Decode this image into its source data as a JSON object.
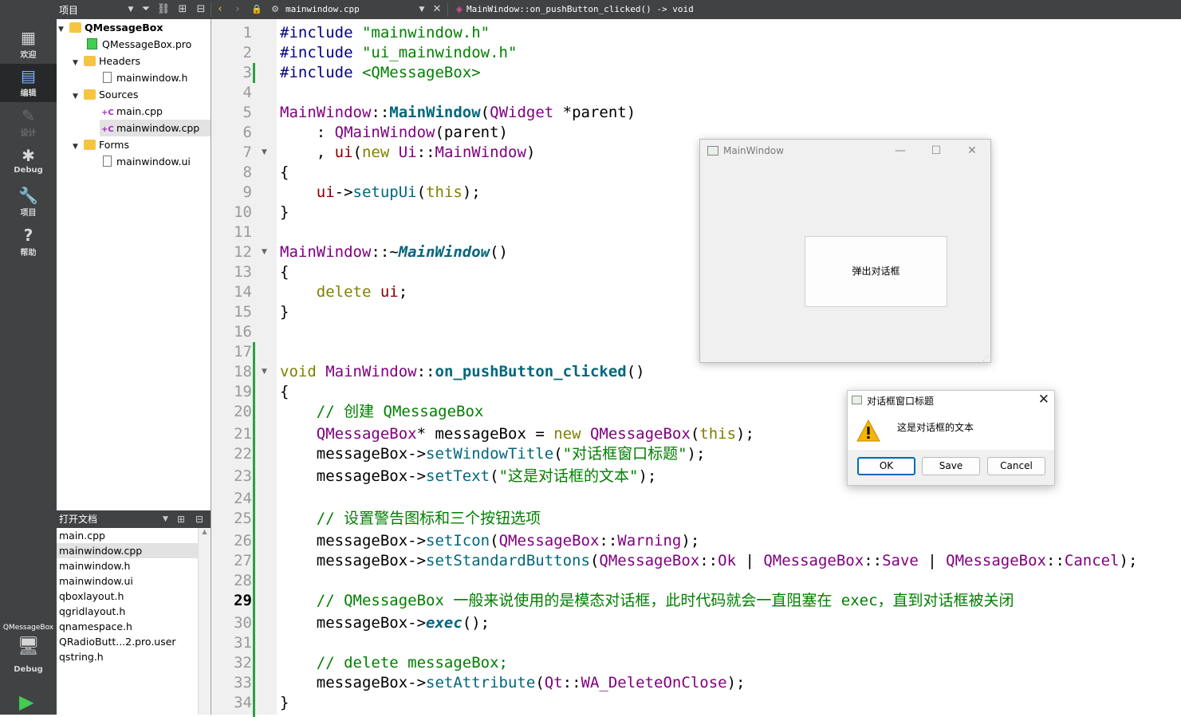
{
  "toolbar": {
    "project_label": "项目",
    "file_name": "mainwindow.cpp",
    "function_signature": "MainWindow::on_pushButton_clicked() -> void"
  },
  "modes": [
    {
      "label": "欢迎",
      "icon": "grid-icon"
    },
    {
      "label": "编辑",
      "icon": "edit-icon"
    },
    {
      "label": "设计",
      "icon": "pencil-icon"
    },
    {
      "label": "Debug",
      "icon": "bug-icon"
    },
    {
      "label": "项目",
      "icon": "wrench-icon"
    },
    {
      "label": "帮助",
      "icon": "help-icon"
    }
  ],
  "kit": {
    "project": "QMessageBox",
    "config": "Debug"
  },
  "tree": {
    "project": "QMessageBox",
    "pro_file": "QMessageBox.pro",
    "headers_label": "Headers",
    "header_file": "mainwindow.h",
    "sources_label": "Sources",
    "source_files": [
      "main.cpp",
      "mainwindow.cpp"
    ],
    "forms_label": "Forms",
    "form_file": "mainwindow.ui"
  },
  "open_docs": {
    "title": "打开文档",
    "items": [
      "main.cpp",
      "mainwindow.cpp",
      "mainwindow.h",
      "mainwindow.ui",
      "qboxlayout.h",
      "qgridlayout.h",
      "qnamespace.h",
      "QRadioButt...2.pro.user",
      "qstring.h"
    ]
  },
  "editor": {
    "current_line": 29,
    "lines": [
      [
        [
          "pp",
          "#include "
        ],
        [
          "str",
          "\"mainwindow.h\""
        ]
      ],
      [
        [
          "pp",
          "#include "
        ],
        [
          "str",
          "\"ui_mainwindow.h\""
        ]
      ],
      [
        [
          "pp",
          "#include "
        ],
        [
          "str",
          "<QMessageBox>"
        ]
      ],
      [],
      [
        [
          "cls",
          "MainWindow"
        ],
        [
          "",
          "::"
        ],
        [
          "fnb",
          "MainWindow"
        ],
        [
          "",
          "("
        ],
        [
          "cls",
          "QWidget"
        ],
        [
          "",
          " *"
        ],
        [
          "",
          "parent"
        ],
        [
          "",
          ")"
        ]
      ],
      [
        [
          "",
          "    : "
        ],
        [
          "cls",
          "QMainWindow"
        ],
        [
          "",
          "(parent)"
        ]
      ],
      [
        [
          "",
          "    , "
        ],
        [
          "fld",
          "ui"
        ],
        [
          "",
          "("
        ],
        [
          "kw",
          "new"
        ],
        [
          "",
          " "
        ],
        [
          "cls",
          "Ui"
        ],
        [
          "",
          "::"
        ],
        [
          "cls",
          "MainWindow"
        ],
        [
          "",
          ")"
        ]
      ],
      [
        [
          "",
          "{"
        ]
      ],
      [
        [
          "",
          "    "
        ],
        [
          "fld",
          "ui"
        ],
        [
          "",
          "->"
        ],
        [
          "fn",
          "setupUi"
        ],
        [
          "",
          "("
        ],
        [
          "kw",
          "this"
        ],
        [
          "",
          ");"
        ]
      ],
      [
        [
          "",
          "}"
        ]
      ],
      [],
      [
        [
          "cls",
          "MainWindow"
        ],
        [
          "",
          "::~"
        ],
        [
          "fnbi",
          "MainWindow"
        ],
        [
          "",
          "()"
        ]
      ],
      [
        [
          "",
          "{"
        ]
      ],
      [
        [
          "",
          "    "
        ],
        [
          "kw",
          "delete"
        ],
        [
          "",
          " "
        ],
        [
          "fld",
          "ui"
        ],
        [
          "",
          ";"
        ]
      ],
      [
        [
          "",
          "}"
        ]
      ],
      [],
      [],
      [
        [
          "kw",
          "void"
        ],
        [
          "",
          " "
        ],
        [
          "cls",
          "MainWindow"
        ],
        [
          "",
          "::"
        ],
        [
          "fnb",
          "on_pushButton_clicked"
        ],
        [
          "",
          "()"
        ]
      ],
      [
        [
          "",
          "{"
        ]
      ],
      [
        [
          "",
          "    "
        ],
        [
          "cmt",
          "// 创建 QMessageBox"
        ]
      ],
      [
        [
          "",
          "    "
        ],
        [
          "cls",
          "QMessageBox"
        ],
        [
          "",
          "* messageBox = "
        ],
        [
          "kw",
          "new"
        ],
        [
          "",
          " "
        ],
        [
          "cls",
          "QMessageBox"
        ],
        [
          "",
          "("
        ],
        [
          "kw",
          "this"
        ],
        [
          "",
          ");"
        ]
      ],
      [
        [
          "",
          "    messageBox->"
        ],
        [
          "fn",
          "setWindowTitle"
        ],
        [
          "",
          "("
        ],
        [
          "str",
          "\"对话框窗口标题\""
        ],
        [
          "",
          ");"
        ]
      ],
      [
        [
          "",
          "    messageBox->"
        ],
        [
          "fn",
          "setText"
        ],
        [
          "",
          "("
        ],
        [
          "str",
          "\"这是对话框的文本\""
        ],
        [
          "",
          ");"
        ]
      ],
      [],
      [
        [
          "",
          "    "
        ],
        [
          "cmt",
          "// 设置警告图标和三个按钮选项"
        ]
      ],
      [
        [
          "",
          "    messageBox->"
        ],
        [
          "fn",
          "setIcon"
        ],
        [
          "",
          "("
        ],
        [
          "cls",
          "QMessageBox"
        ],
        [
          "",
          "::"
        ],
        [
          "enm",
          "Warning"
        ],
        [
          "",
          ");"
        ]
      ],
      [
        [
          "",
          "    messageBox->"
        ],
        [
          "fn",
          "setStandardButtons"
        ],
        [
          "",
          "("
        ],
        [
          "cls",
          "QMessageBox"
        ],
        [
          "",
          "::"
        ],
        [
          "enm",
          "Ok"
        ],
        [
          "",
          " | "
        ],
        [
          "cls",
          "QMessageBox"
        ],
        [
          "",
          "::"
        ],
        [
          "enm",
          "Save"
        ],
        [
          "",
          " | "
        ],
        [
          "cls",
          "QMessageBox"
        ],
        [
          "",
          "::"
        ],
        [
          "enm",
          "Cancel"
        ],
        [
          "",
          ");"
        ]
      ],
      [],
      [
        [
          "",
          "    "
        ],
        [
          "cmt",
          "// QMessageBox 一般来说使用的是模态对话框，此时代码就会一直阻塞在 exec，直到对话框被关闭"
        ]
      ],
      [
        [
          "",
          "    messageBox->"
        ],
        [
          "fnbi",
          "exec"
        ],
        [
          "",
          "();"
        ]
      ],
      [],
      [
        [
          "",
          "    "
        ],
        [
          "cmt",
          "// delete messageBox;"
        ]
      ],
      [
        [
          "",
          "    messageBox->"
        ],
        [
          "fn",
          "setAttribute"
        ],
        [
          "",
          "("
        ],
        [
          "cls",
          "Qt"
        ],
        [
          "",
          "::"
        ],
        [
          "enm",
          "WA_DeleteOnClose"
        ],
        [
          "",
          ");"
        ]
      ],
      [
        [
          "",
          "}"
        ]
      ]
    ]
  },
  "app_window": {
    "title": "MainWindow",
    "button_label": "弹出对话框"
  },
  "message_box": {
    "title": "对话框窗口标题",
    "text": "这是对话框的文本",
    "icon": "warning-icon",
    "buttons": [
      "OK",
      "Save",
      "Cancel"
    ]
  },
  "colors": {
    "accent": "#0067c0",
    "sidebar": "#404244",
    "warning": "#f5b400"
  }
}
